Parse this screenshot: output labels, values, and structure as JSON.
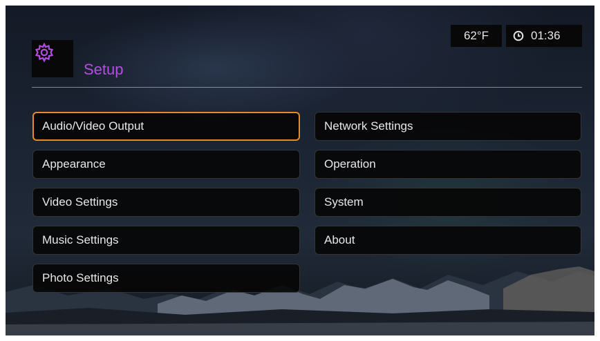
{
  "header": {
    "title": "Setup",
    "icon": "gear-icon",
    "accent_color": "#b44ee0"
  },
  "status": {
    "temperature": "62°F",
    "time": "01:36",
    "clock_icon": "clock-icon"
  },
  "menu": {
    "selected_color": "#e58a2e",
    "left": [
      {
        "label": "Audio/Video Output",
        "selected": true
      },
      {
        "label": "Appearance"
      },
      {
        "label": "Video Settings"
      },
      {
        "label": "Music Settings"
      },
      {
        "label": "Photo Settings"
      }
    ],
    "right": [
      {
        "label": "Network Settings"
      },
      {
        "label": "Operation"
      },
      {
        "label": "System"
      },
      {
        "label": "About"
      }
    ]
  }
}
